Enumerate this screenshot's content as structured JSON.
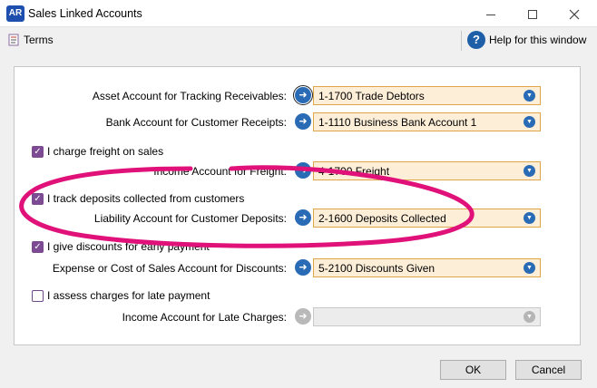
{
  "window": {
    "app_badge": "AR",
    "title": "Sales Linked Accounts",
    "icons": {
      "minimize": "minimize-icon",
      "maximize": "maximize-icon",
      "close": "close-icon"
    }
  },
  "toolbar": {
    "terms_label": "Terms",
    "help_label": "Help for this window",
    "help_glyph": "?"
  },
  "fields": {
    "receivables": {
      "label": "Asset Account for Tracking Receivables:",
      "value": "1-1700 Trade Debtors"
    },
    "bank": {
      "label": "Bank Account for Customer Receipts:",
      "value": "1-1110 Business Bank Account 1"
    },
    "freight": {
      "label": "Income Account for Freight:",
      "value": "4-1700 Freight"
    },
    "deposits": {
      "label": "Liability Account for Customer Deposits:",
      "value": "2-1600 Deposits Collected"
    },
    "discounts": {
      "label": "Expense or Cost of Sales Account for Discounts:",
      "value": "5-2100 Discounts Given"
    },
    "late_charges": {
      "label": "Income Account for Late Charges:",
      "value": ""
    }
  },
  "checkboxes": {
    "freight": {
      "label": "I charge freight on sales",
      "checked": true
    },
    "deposits": {
      "label": "I track deposits collected from customers",
      "checked": true
    },
    "discounts": {
      "label": "I give discounts for early payment",
      "checked": true
    },
    "late": {
      "label": "I assess charges for late payment",
      "checked": false
    }
  },
  "buttons": {
    "ok": "OK",
    "cancel": "Cancel"
  },
  "glyphs": {
    "arrow": "➜",
    "dropdown": "▼",
    "check": "✓"
  },
  "colors": {
    "accent": "#2a6bb5",
    "field_bg": "#fdeed8",
    "field_border": "#e0a44a",
    "annotation": "#e0127a",
    "checkbox": "#7d4b93"
  }
}
